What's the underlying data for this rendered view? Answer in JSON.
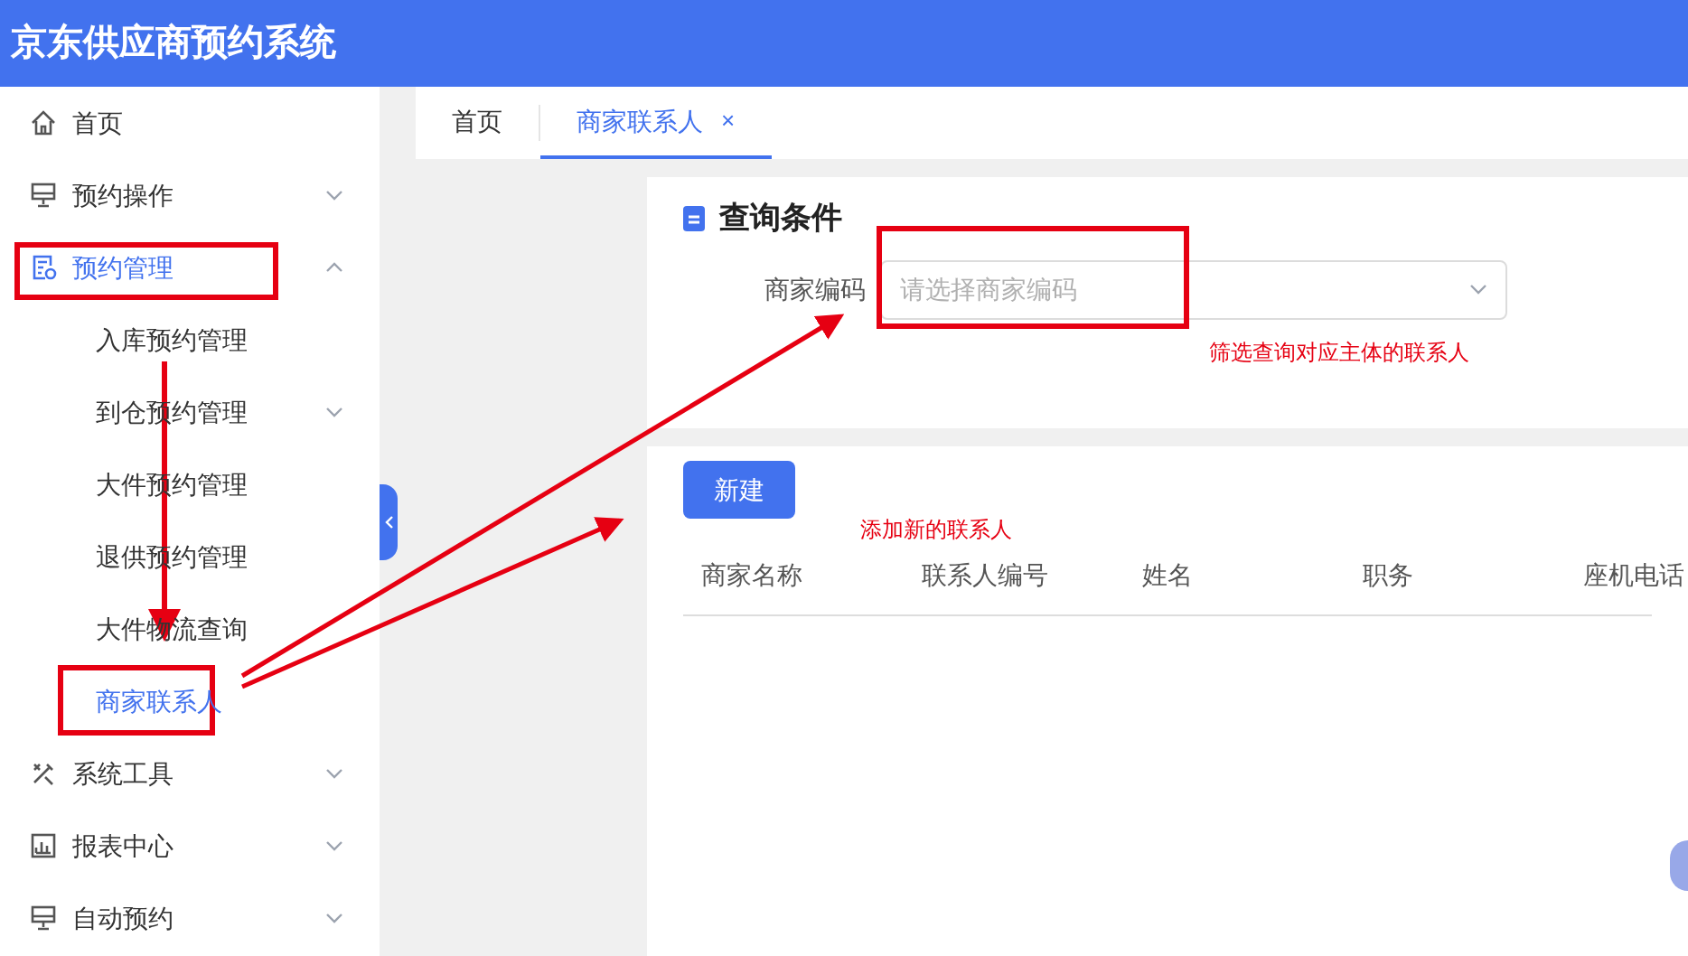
{
  "header": {
    "title": "京东供应商预约系统"
  },
  "sidebar": {
    "items": [
      {
        "label": "首页",
        "selected": false
      },
      {
        "label": "预约操作",
        "expanded": false,
        "selected": false
      },
      {
        "label": "预约管理",
        "expanded": true,
        "selected": true,
        "children": [
          {
            "label": "入库预约管理",
            "selected": false
          },
          {
            "label": "到仓预约管理",
            "selected": false,
            "expandable": true
          },
          {
            "label": "大件预约管理",
            "selected": false
          },
          {
            "label": "退供预约管理",
            "selected": false
          },
          {
            "label": "大件物流查询",
            "selected": false
          },
          {
            "label": "商家联系人",
            "selected": true
          }
        ]
      },
      {
        "label": "系统工具",
        "expanded": false,
        "selected": false
      },
      {
        "label": "报表中心",
        "expanded": false,
        "selected": false
      },
      {
        "label": "自动预约",
        "expanded": false,
        "selected": false
      }
    ]
  },
  "tabs": [
    {
      "label": "首页",
      "selected": false,
      "closable": false
    },
    {
      "label": "商家联系人",
      "close": "×",
      "selected": true,
      "closable": true
    }
  ],
  "query": {
    "title": "查询条件",
    "field_label": "商家编码",
    "placeholder": "请选择商家编码"
  },
  "new_button": "新建",
  "table": {
    "columns": [
      "商家名称",
      "联系人编号",
      "姓名",
      "职务",
      "座机电话"
    ]
  },
  "annotations": {
    "filter_note": "筛选查询对应主体的联系人",
    "new_note": "添加新的联系人"
  }
}
